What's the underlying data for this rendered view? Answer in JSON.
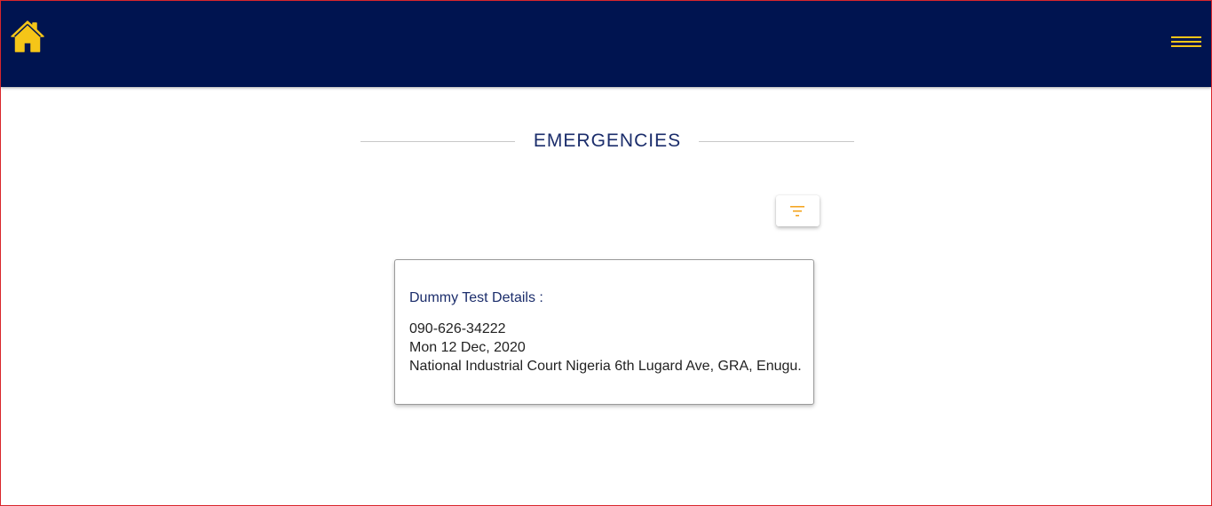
{
  "header": {
    "home_icon": "home-icon",
    "menu_icon": "hamburger-menu-icon",
    "bg_color": "#001450",
    "accent_color": "#f5c518"
  },
  "page": {
    "title": "EMERGENCIES"
  },
  "toolbar": {
    "filter_icon": "filter-icon",
    "filter_color": "#f5a623"
  },
  "emergencies": [
    {
      "title": "Dummy Test Details :",
      "phone": "090-626-34222",
      "date": "Mon 12 Dec, 2020",
      "address": "National Industrial Court Nigeria 6th Lugard Ave, GRA, Enugu."
    }
  ]
}
